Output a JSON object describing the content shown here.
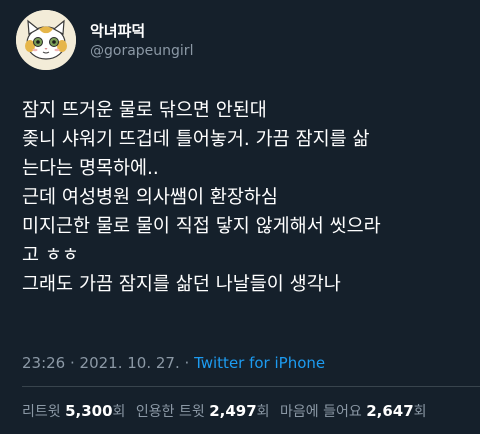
{
  "author": {
    "display_name": "악녀퍄덕",
    "handle": "@gorapeungirl",
    "avatar_icon": "cartoon-cat-avatar"
  },
  "tweet": {
    "lines": [
      "잠지 뜨거운 물로 닦으면 안된대",
      "좆니 샤워기 뜨겁데 틀어놓거. 가끔 잠지를 삶",
      "는다는 명목하에..",
      "근데 여성병원 의사쌤이 환장하심",
      "미지근한 물로 물이 직접 닿지 않게해서 씻으라",
      "고 ㅎㅎ",
      "그래도 가끔 잠지를 삶던 나날들이 생각나"
    ]
  },
  "meta": {
    "time": "23:26",
    "separator1": " · ",
    "date": "2021. 10. 27.",
    "separator2": " · ",
    "source": "Twitter for iPhone"
  },
  "stats": {
    "retweets_label": "리트윗",
    "retweets_value": "5,300",
    "retweets_unit": "회",
    "quotes_label": "인용한 트윗",
    "quotes_value": "2,497",
    "quotes_unit": "회",
    "likes_label": "마음에 들어요",
    "likes_value": "2,647",
    "likes_unit": "회"
  },
  "colors": {
    "background": "#15202b",
    "text": "#ffffff",
    "secondary": "#8b98a5",
    "link": "#1d9bf0",
    "divider": "#38444d"
  }
}
